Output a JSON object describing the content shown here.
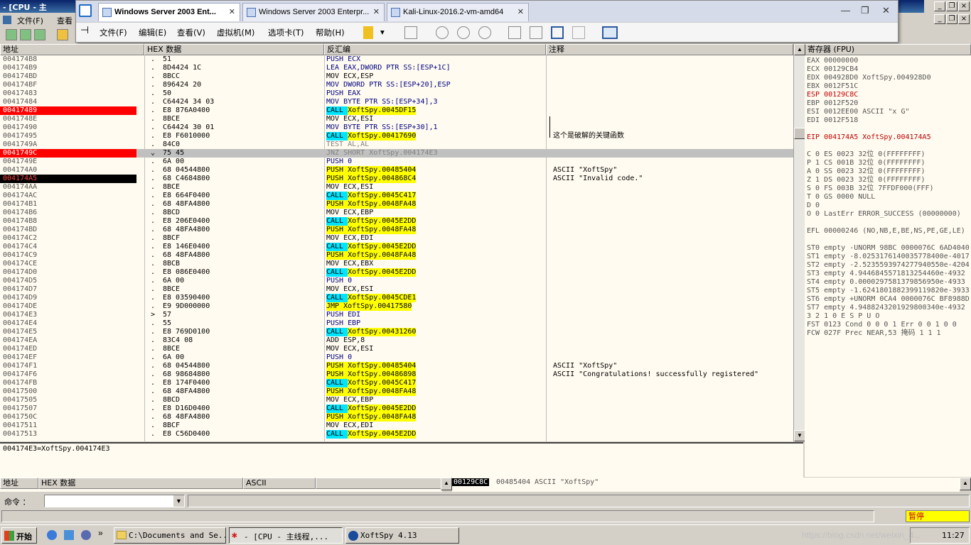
{
  "olly": {
    "title": "- [CPU - 主",
    "menu": [
      "文件(F)",
      "查看"
    ]
  },
  "vm": {
    "tabs": [
      {
        "label": "Windows Server 2003 Ent..."
      },
      {
        "label": "Windows Server 2003 Enterpr..."
      },
      {
        "label": "Kali-Linux-2016.2-vm-amd64"
      }
    ],
    "menu": [
      "文件(F)",
      "编辑(E)",
      "查看(V)",
      "虚拟机(M)",
      "选项卡(T)",
      "帮助(H)"
    ]
  },
  "disasm": {
    "headers": {
      "addr": "地址",
      "hex": "HEX 数据",
      "dis": "反汇编",
      "comment": "注释"
    },
    "rows": [
      {
        "addr": "004174B8",
        "mark": ".",
        "hex": "51",
        "dis": "PUSH ECX",
        "com": ""
      },
      {
        "addr": "004174B9",
        "mark": ".",
        "hex": "8D4424 1C",
        "dis": "LEA EAX,DWORD PTR SS:[ESP+1C]",
        "com": ""
      },
      {
        "addr": "004174BD",
        "mark": ".",
        "hex": "8BCC",
        "dis": "MOV ECX,ESP",
        "com": ""
      },
      {
        "addr": "004174BF",
        "mark": ".",
        "hex": "896424 20",
        "dis": "MOV DWORD PTR SS:[ESP+20],ESP",
        "com": ""
      },
      {
        "addr": "00417483",
        "mark": ".",
        "hex": "50",
        "dis": "PUSH EAX",
        "com": ""
      },
      {
        "addr": "00417484",
        "mark": ".",
        "hex": "C64424 34 03",
        "dis": "MOV BYTE PTR SS:[ESP+34],3",
        "com": ""
      },
      {
        "addr": "00417489",
        "mark": ".",
        "hex": "E8 876A0400",
        "dis": "CALL XoftSpy.0045DF15",
        "com": ""
      },
      {
        "addr": "0041748E",
        "mark": ".",
        "hex": "8BCE",
        "dis": "MOV ECX,ESI",
        "com": ""
      },
      {
        "addr": "00417490",
        "mark": ".",
        "hex": "C64424 30 01",
        "dis": "MOV BYTE PTR SS:[ESP+30],1",
        "com": ""
      },
      {
        "addr": "00417495",
        "mark": ".",
        "hex": "E8 F6010000",
        "dis": "CALL XoftSpy.00417690",
        "com": "这个是破解的关键函数"
      },
      {
        "addr": "0041749A",
        "mark": ".",
        "hex": "84C0",
        "dis": "TEST AL,AL",
        "com": ""
      },
      {
        "addr": "0041749C",
        "mark": "⌄",
        "hex": "75 45",
        "dis": "JNZ SHORT XoftSpy.004174E3",
        "com": ""
      },
      {
        "addr": "0041749E",
        "mark": ".",
        "hex": "6A 00",
        "dis": "PUSH 0",
        "com": ""
      },
      {
        "addr": "004174A0",
        "mark": ".",
        "hex": "68 04544800",
        "dis": "PUSH XoftSpy.00485404",
        "com": "ASCII \"XoftSpy\""
      },
      {
        "addr": "004174A5",
        "mark": ".",
        "hex": "68 C4684800",
        "dis": "PUSH XoftSpy.004868C4",
        "com": "ASCII \"Invalid code.\""
      },
      {
        "addr": "004174AA",
        "mark": ".",
        "hex": "8BCE",
        "dis": "MOV ECX,ESI",
        "com": ""
      },
      {
        "addr": "004174AC",
        "mark": ".",
        "hex": "E8 664F0400",
        "dis": "CALL XoftSpy.0045C417",
        "com": ""
      },
      {
        "addr": "004174B1",
        "mark": ".",
        "hex": "68 48FA4800",
        "dis": "PUSH XoftSpy.0048FA48",
        "com": ""
      },
      {
        "addr": "004174B6",
        "mark": ".",
        "hex": "8BCD",
        "dis": "MOV ECX,EBP",
        "com": ""
      },
      {
        "addr": "004174B8",
        "mark": ".",
        "hex": "E8 206E0400",
        "dis": "CALL XoftSpy.0045E2DD",
        "com": ""
      },
      {
        "addr": "004174BD",
        "mark": ".",
        "hex": "68 48FA4800",
        "dis": "PUSH XoftSpy.0048FA48",
        "com": ""
      },
      {
        "addr": "004174C2",
        "mark": ".",
        "hex": "8BCF",
        "dis": "MOV ECX,EDI",
        "com": ""
      },
      {
        "addr": "004174C4",
        "mark": ".",
        "hex": "E8 146E0400",
        "dis": "CALL XoftSpy.0045E2DD",
        "com": ""
      },
      {
        "addr": "004174C9",
        "mark": ".",
        "hex": "68 48FA4800",
        "dis": "PUSH XoftSpy.0048FA48",
        "com": ""
      },
      {
        "addr": "004174CE",
        "mark": ".",
        "hex": "8BCB",
        "dis": "MOV ECX,EBX",
        "com": ""
      },
      {
        "addr": "004174D0",
        "mark": ".",
        "hex": "E8 086E0400",
        "dis": "CALL XoftSpy.0045E2DD",
        "com": ""
      },
      {
        "addr": "004174D5",
        "mark": ".",
        "hex": "6A 00",
        "dis": "PUSH 0",
        "com": ""
      },
      {
        "addr": "004174D7",
        "mark": ".",
        "hex": "8BCE",
        "dis": "MOV ECX,ESI",
        "com": ""
      },
      {
        "addr": "004174D9",
        "mark": ".",
        "hex": "E8 03590400",
        "dis": "CALL XoftSpy.0045CDE1",
        "com": ""
      },
      {
        "addr": "004174DE",
        "mark": ".",
        "hex": "E9 9D000000",
        "dis": "JMP XoftSpy.00417580",
        "com": ""
      },
      {
        "addr": "004174E3",
        "mark": ">",
        "hex": "57",
        "dis": "PUSH EDI",
        "com": ""
      },
      {
        "addr": "004174E4",
        "mark": ".",
        "hex": "55",
        "dis": "PUSH EBP",
        "com": ""
      },
      {
        "addr": "004174E5",
        "mark": ".",
        "hex": "E8 769D0100",
        "dis": "CALL XoftSpy.00431260",
        "com": ""
      },
      {
        "addr": "004174EA",
        "mark": ".",
        "hex": "83C4 08",
        "dis": "ADD ESP,8",
        "com": ""
      },
      {
        "addr": "004174ED",
        "mark": ".",
        "hex": "8BCE",
        "dis": "MOV ECX,ESI",
        "com": ""
      },
      {
        "addr": "004174EF",
        "mark": ".",
        "hex": "6A 00",
        "dis": "PUSH 0",
        "com": ""
      },
      {
        "addr": "004174F1",
        "mark": ".",
        "hex": "68 04544800",
        "dis": "PUSH XoftSpy.00485404",
        "com": "ASCII \"XoftSpy\""
      },
      {
        "addr": "004174F6",
        "mark": ".",
        "hex": "68 98684800",
        "dis": "PUSH XoftSpy.00486898",
        "com": "ASCII \"Congratulations! successfully registered\""
      },
      {
        "addr": "004174FB",
        "mark": ".",
        "hex": "E8 174F0400",
        "dis": "CALL XoftSpy.0045C417",
        "com": ""
      },
      {
        "addr": "00417500",
        "mark": ".",
        "hex": "68 48FA4800",
        "dis": "PUSH XoftSpy.0048FA48",
        "com": ""
      },
      {
        "addr": "00417505",
        "mark": ".",
        "hex": "8BCD",
        "dis": "MOV ECX,EBP",
        "com": ""
      },
      {
        "addr": "00417507",
        "mark": ".",
        "hex": "E8 D16D0400",
        "dis": "CALL XoftSpy.0045E2DD",
        "com": ""
      },
      {
        "addr": "0041750C",
        "mark": ".",
        "hex": "68 48FA4800",
        "dis": "PUSH XoftSpy.0048FA48",
        "com": ""
      },
      {
        "addr": "00417511",
        "mark": ".",
        "hex": "8BCF",
        "dis": "MOV ECX,EDI",
        "com": ""
      },
      {
        "addr": "00417513",
        "mark": ".",
        "hex": "E8 C56D0400",
        "dis": "CALL XoftSpy.0045E2DD",
        "com": ""
      }
    ]
  },
  "registers": {
    "header": "寄存器 (FPU)",
    "lines": [
      "EAX 00000000",
      "ECX 00129CB4",
      "EDX 004928D0 XoftSpy.004928D0",
      "EBX 0012F51C",
      "ESP 00129C8C",
      "EBP 0012F520",
      "ESI 0012EE00 ASCII \"x G\"",
      "EDI 0012F518",
      "",
      "EIP 004174A5 XoftSpy.004174A5",
      "",
      "C 0   ES 0023 32位 0(FFFFFFFF)",
      "P 1   CS 001B 32位 0(FFFFFFFF)",
      "A 0   SS 0023 32位 0(FFFFFFFF)",
      "Z 1   DS 0023 32位 0(FFFFFFFF)",
      "S 0   FS 003B 32位 7FFDF000(FFF)",
      "T 0   GS 0000 NULL",
      "D 0",
      "O 0   LastErr ERROR_SUCCESS (00000000)",
      "",
      "EFL 00000246 (NO,NB,E,BE,NS,PE,GE,LE)",
      "",
      "ST0 empty -UNORM 98BC 0000076C 6AD4040",
      "ST1 empty -8.0253176140035778400e-4017",
      "ST2 empty -2.5235593974277940550e-4204",
      "ST3 empty 4.9446845571813254460e-4932",
      "ST4 empty 0.0000297581379856950e-4933",
      "ST5 empty -1.6241801882399119820e-3933",
      "ST6 empty +UNORM 0CA4 0000076C BF8988D",
      "ST7 empty 4.9488243201929800340e-4932",
      "               3 2 1 0      E S P U O",
      "FST 0123  Cond 0 0 0 1  Err 0 0 1 0 0",
      "FCW 027F  Prec NEAR,53  掩码    1 1 1"
    ]
  },
  "info": "004174E3=XoftSpy.004174E3",
  "dump": {
    "headers": [
      "地址",
      "HEX 数据",
      "ASCII"
    ]
  },
  "stack": {
    "addr": "00129C8C",
    "val": "00485404",
    "com": "ASCII \"XoftSpy\""
  },
  "command": {
    "label": "命令 ："
  },
  "status": {
    "state": "暂停"
  },
  "taskbar": {
    "start": "开始",
    "items": [
      "C:\\Documents and Se...",
      "- [CPU - 主线程,...",
      "XoftSpy 4.13"
    ],
    "clock": "11:27",
    "watermark": "https://blog.csdn.net/weixin_4..."
  }
}
